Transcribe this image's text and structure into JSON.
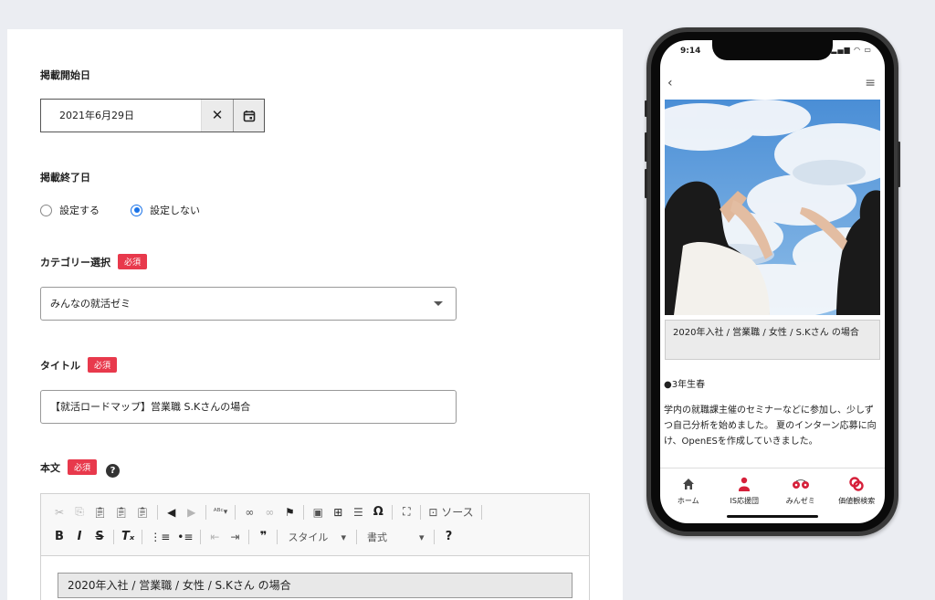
{
  "form": {
    "start_date": {
      "label": "掲載開始日",
      "value": "2021年6月29日",
      "clear": "✕"
    },
    "end_date": {
      "label": "掲載終了日",
      "options": [
        {
          "label": "設定する",
          "selected": false
        },
        {
          "label": "設定しない",
          "selected": true
        }
      ]
    },
    "category": {
      "label": "カテゴリー選択",
      "required": "必須",
      "value": "みんなの就活ゼミ"
    },
    "title": {
      "label": "タイトル",
      "required": "必須",
      "value": "【就活ロードマップ】営業職 S.Kさんの場合"
    },
    "body": {
      "label": "本文",
      "required": "必須",
      "help": "?",
      "toolbar": {
        "row1": [
          "cut-icon",
          "copy-icon",
          "paste-icon",
          "paste-text-icon",
          "paste-word-icon",
          "undo-icon",
          "redo-icon",
          "spellcheck-icon",
          "link-icon",
          "unlink-icon",
          "anchor-icon",
          "image-icon",
          "table-icon",
          "horizontal-line-icon",
          "special-char-icon",
          "maximize-icon",
          "source-icon"
        ],
        "source_label": "ソース",
        "row2": {
          "bold": "B",
          "italic": "I",
          "strike": "S",
          "quote": "❞",
          "style_label": "スタイル",
          "format_label": "書式",
          "help": "?"
        }
      },
      "content": "2020年入社 / 営業職 / 女性 / S.Kさん の場合"
    }
  },
  "phone": {
    "time": "9:14",
    "status_icons": "▂▄▆ ◠ ▭",
    "back": "‹",
    "menu": "≡",
    "caption": "2020年入社 / 営業職 / 女性 / S.Kさん の場合",
    "section": "●3年生春",
    "paragraph": "学内の就職課主催のセミナーなどに参加し、少しずつ自己分析を始めました。 夏のインターン応募に向け、OpenESを作成していきました。",
    "tabs": [
      {
        "label": "ホーム",
        "icon": "home-icon",
        "color": "#444444"
      },
      {
        "label": "IS応援団",
        "icon": "person-icon",
        "color": "#d6203a"
      },
      {
        "label": "みんゼミ",
        "icon": "cherries-icon",
        "color": "#d6203a"
      },
      {
        "label": "価値観検索",
        "icon": "search-link-icon",
        "color": "#d6203a"
      }
    ]
  },
  "colors": {
    "accent": "#e8394c",
    "radio": "#1a73e8",
    "page_bg": "#ebedf2"
  }
}
